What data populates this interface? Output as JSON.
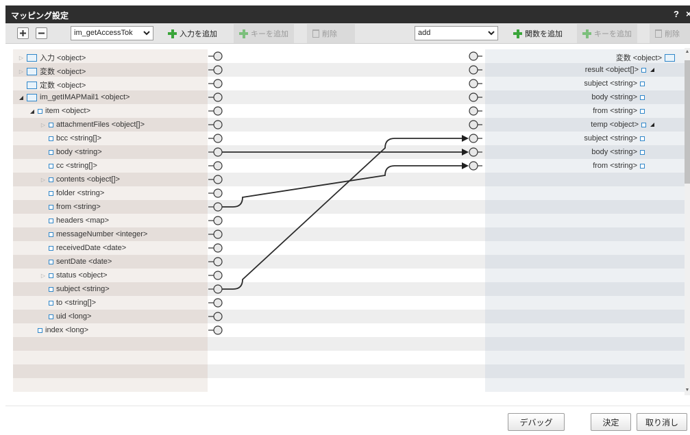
{
  "dialog": {
    "title": "マッピング設定",
    "help": "?",
    "close": "×"
  },
  "toolbar": {
    "left_select": "im_getAccessTok",
    "add_input": "入力を追加",
    "add_key_left": "キーを追加",
    "delete_left": "削除",
    "right_select": "add",
    "add_function": "関数を追加",
    "add_key_right": "キーを追加",
    "delete_right": "削除"
  },
  "left_tree": [
    {
      "label": "入力 <object>",
      "kind": "object",
      "toggle": "closed",
      "depth": 0
    },
    {
      "label": "変数 <object>",
      "kind": "object",
      "toggle": "closed",
      "depth": 0
    },
    {
      "label": "定数 <object>",
      "kind": "object",
      "toggle": "none",
      "depth": 0
    },
    {
      "label": "im_getIMAPMail1 <object>",
      "kind": "object",
      "toggle": "open",
      "depth": 0
    },
    {
      "label": "item <object>",
      "kind": "field",
      "toggle": "open",
      "depth": 1
    },
    {
      "label": "attachmentFiles <object[]>",
      "kind": "field",
      "toggle": "closed",
      "depth": 2
    },
    {
      "label": "bcc <string[]>",
      "kind": "field",
      "toggle": "none",
      "depth": 2
    },
    {
      "label": "body <string>",
      "kind": "field",
      "toggle": "none",
      "depth": 2
    },
    {
      "label": "cc <string[]>",
      "kind": "field",
      "toggle": "none",
      "depth": 2
    },
    {
      "label": "contents <object[]>",
      "kind": "field",
      "toggle": "closed",
      "depth": 2
    },
    {
      "label": "folder <string>",
      "kind": "field",
      "toggle": "none",
      "depth": 2
    },
    {
      "label": "from <string>",
      "kind": "field",
      "toggle": "none",
      "depth": 2
    },
    {
      "label": "headers <map>",
      "kind": "field",
      "toggle": "none",
      "depth": 2
    },
    {
      "label": "messageNumber <integer>",
      "kind": "field",
      "toggle": "none",
      "depth": 2
    },
    {
      "label": "receivedDate <date>",
      "kind": "field",
      "toggle": "none",
      "depth": 2
    },
    {
      "label": "sentDate <date>",
      "kind": "field",
      "toggle": "none",
      "depth": 2
    },
    {
      "label": "status <object>",
      "kind": "field",
      "toggle": "closed",
      "depth": 2
    },
    {
      "label": "subject <string>",
      "kind": "field",
      "toggle": "none",
      "depth": 2
    },
    {
      "label": "to <string[]>",
      "kind": "field",
      "toggle": "none",
      "depth": 2
    },
    {
      "label": "uid <long>",
      "kind": "field",
      "toggle": "none",
      "depth": 2
    },
    {
      "label": "index <long>",
      "kind": "field",
      "toggle": "none",
      "depth": 1
    }
  ],
  "right_tree": [
    {
      "label": "変数 <object>",
      "kind": "object",
      "depth": 0
    },
    {
      "label": "result <object[]>",
      "kind": "field",
      "depth": 1,
      "corner": true
    },
    {
      "label": "subject <string>",
      "kind": "field",
      "depth": 2
    },
    {
      "label": "body <string>",
      "kind": "field",
      "depth": 2
    },
    {
      "label": "from <string>",
      "kind": "field",
      "depth": 2
    },
    {
      "label": "temp <object>",
      "kind": "field",
      "depth": 1,
      "corner": true
    },
    {
      "label": "subject <string>",
      "kind": "field",
      "depth": 2
    },
    {
      "label": "body <string>",
      "kind": "field",
      "depth": 2
    },
    {
      "label": "from <string>",
      "kind": "field",
      "depth": 2
    }
  ],
  "mappings": [
    {
      "from": "subject <string>",
      "to": "temp.subject <string>"
    },
    {
      "from": "body <string>",
      "to": "temp.body <string>"
    },
    {
      "from": "from <string>",
      "to": "temp.from <string>"
    }
  ],
  "footer": {
    "debug": "デバッグ",
    "ok": "決定",
    "cancel": "取り消し"
  }
}
